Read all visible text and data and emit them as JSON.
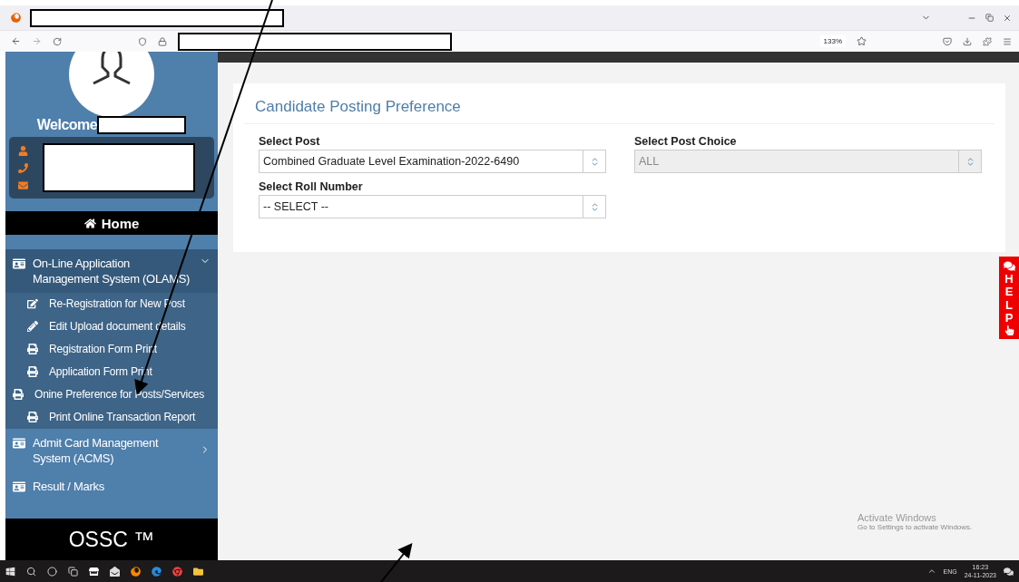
{
  "browser": {
    "zoom": "133%"
  },
  "sidebar": {
    "welcome": "Welcome",
    "home": "Home",
    "menu": [
      {
        "label": "On-Line Application Management System (OLAMS)",
        "expanded": true,
        "children": [
          {
            "label": "Re-Registration for New Post",
            "kind": "edit"
          },
          {
            "label": "Edit Upload document details",
            "kind": "pencil"
          },
          {
            "label": "Registration Form Print",
            "kind": "print"
          },
          {
            "label": "Application Form Print",
            "kind": "print"
          },
          {
            "label": "Onine Preference for Posts/Services",
            "kind": "print"
          },
          {
            "label": "Print Online Transaction Report",
            "kind": "print"
          }
        ]
      },
      {
        "label": "Admit Card Management System (ACMS)",
        "expanded": false
      },
      {
        "label": "Result / Marks"
      }
    ],
    "footer": "OSSC ™"
  },
  "card": {
    "title": "Candidate Posting Preference",
    "fields": [
      {
        "label": "Select Post",
        "value": "Combined Graduate Level Examination-2022-6490",
        "disabled": false
      },
      {
        "label": "Select Post Choice",
        "value": "ALL",
        "disabled": true
      },
      {
        "label": "Select Roll Number",
        "value": "-- SELECT --",
        "disabled": false
      }
    ]
  },
  "help": "HELP",
  "watermark": {
    "title": "Activate Windows",
    "subtitle": "Go to Settings to activate Windows."
  },
  "taskbar": {
    "language": "ENG",
    "time": "16:23",
    "date": "24-11-2023"
  }
}
